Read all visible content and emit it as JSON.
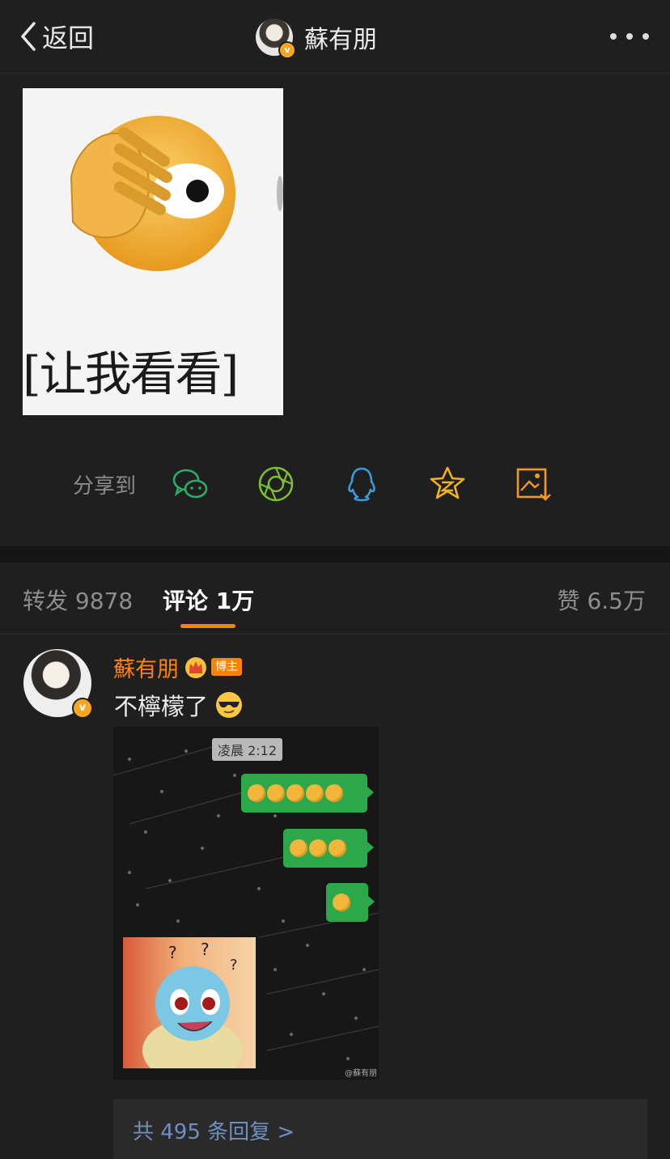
{
  "nav": {
    "back_label": "返回",
    "title": "蘇有朋"
  },
  "post": {
    "image_caption": "[让我看看]"
  },
  "share": {
    "label": "分享到",
    "icons": [
      "wechat-icon",
      "moments-icon",
      "qq-icon",
      "qzone-icon",
      "save-image-icon"
    ]
  },
  "tabs": {
    "repost": "转发 9878",
    "comment": "评论 1万",
    "like": "赞 6.5万"
  },
  "comment": {
    "author": "蘇有朋",
    "badge": "博主",
    "text": "不檸檬了",
    "image": {
      "time": "凌晨 2:12",
      "watermark": "@蘇有朋"
    },
    "replies_link": "共 495 条回复 >"
  },
  "colors": {
    "accent": "#ff8200",
    "link": "#6f8fbf",
    "background": "#1f1f1f"
  }
}
